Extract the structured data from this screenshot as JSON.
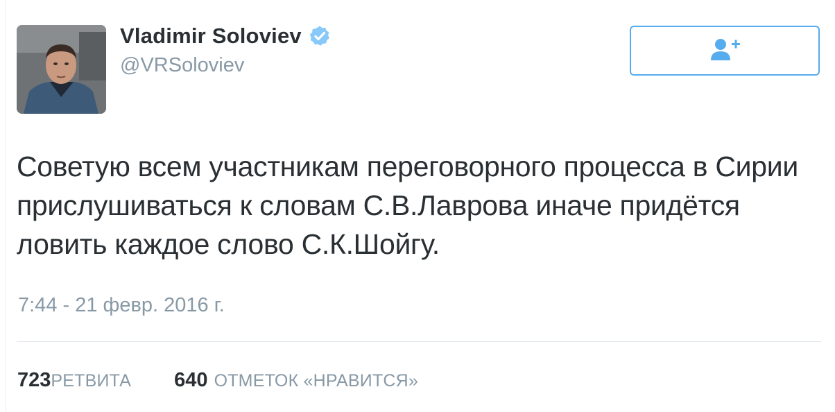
{
  "user": {
    "name": "Vladimir Soloviev",
    "handle": "@VRSoloviev",
    "verified": true
  },
  "follow_button": {
    "icon": "follow-user-plus-icon"
  },
  "tweet": {
    "text": "Советую всем участникам переговорного процесса в Сирии\nприслушиваться к словам С.В.Лаврова иначе придётся\nловить каждое слово С.К.Шойгу.",
    "timestamp": "7:44 - 21 февр. 2016 г."
  },
  "stats": {
    "retweets_count": "723",
    "retweets_label": "РЕТВИТА",
    "likes_count": "640",
    "likes_label": "ОТМЕТОК «НРАВИТСЯ»"
  },
  "colors": {
    "accent": "#55acee",
    "text": "#292f33",
    "muted": "#8899a6"
  }
}
